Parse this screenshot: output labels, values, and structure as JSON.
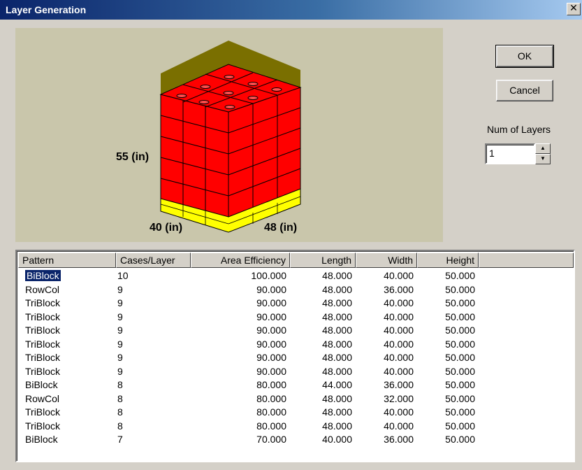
{
  "window": {
    "title": "Layer Generation",
    "close_glyph": "✕"
  },
  "preview": {
    "height_label": "55 (in)",
    "width_label": "40 (in)",
    "depth_label": "48 (in)",
    "colors": {
      "case": "#ff0000",
      "pallet": "#ffff00",
      "backdrop": "#c9c6ab",
      "shadow": "#7a6f00"
    }
  },
  "buttons": {
    "ok": "OK",
    "cancel": "Cancel"
  },
  "layers": {
    "label": "Num of Layers",
    "value": "1",
    "up_icon": "▲",
    "down_icon": "▼"
  },
  "table": {
    "columns": [
      "Pattern",
      "Cases/Layer",
      "Area Efficiency",
      "Length",
      "Width",
      "Height"
    ],
    "rows": [
      [
        "BiBlock",
        "10",
        "100.000",
        "48.000",
        "40.000",
        "50.000"
      ],
      [
        "RowCol",
        "9",
        "90.000",
        "48.000",
        "36.000",
        "50.000"
      ],
      [
        "TriBlock",
        "9",
        "90.000",
        "48.000",
        "40.000",
        "50.000"
      ],
      [
        "TriBlock",
        "9",
        "90.000",
        "48.000",
        "40.000",
        "50.000"
      ],
      [
        "TriBlock",
        "9",
        "90.000",
        "48.000",
        "40.000",
        "50.000"
      ],
      [
        "TriBlock",
        "9",
        "90.000",
        "48.000",
        "40.000",
        "50.000"
      ],
      [
        "TriBlock",
        "9",
        "90.000",
        "48.000",
        "40.000",
        "50.000"
      ],
      [
        "TriBlock",
        "9",
        "90.000",
        "48.000",
        "40.000",
        "50.000"
      ],
      [
        "BiBlock",
        "8",
        "80.000",
        "44.000",
        "36.000",
        "50.000"
      ],
      [
        "RowCol",
        "8",
        "80.000",
        "48.000",
        "32.000",
        "50.000"
      ],
      [
        "TriBlock",
        "8",
        "80.000",
        "48.000",
        "40.000",
        "50.000"
      ],
      [
        "TriBlock",
        "8",
        "80.000",
        "48.000",
        "40.000",
        "50.000"
      ],
      [
        "BiBlock",
        "7",
        "70.000",
        "40.000",
        "36.000",
        "50.000"
      ]
    ],
    "selected_row": 0
  }
}
